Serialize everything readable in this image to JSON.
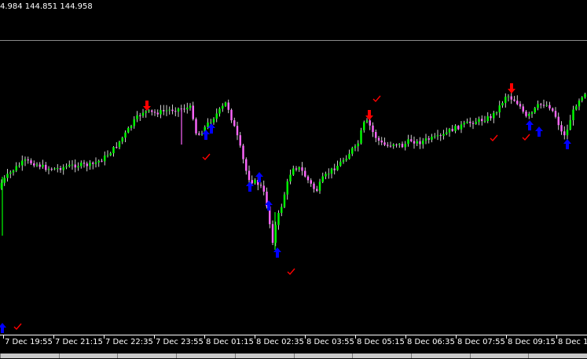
{
  "header": {
    "ohlc_text": "4.984 144.851 144.958"
  },
  "time_axis": {
    "labels": [
      "7 Dec 19:55",
      "7 Dec 21:15",
      "7 Dec 22:35",
      "7 Dec 23:55",
      "8 Dec 01:15",
      "8 Dec 02:35",
      "8 Dec 03:55",
      "8 Dec 05:15",
      "8 Dec 06:35",
      "8 Dec 07:55",
      "8 Dec 09:15",
      "8 Dec 10"
    ]
  },
  "tabs": [
    "",
    "",
    "",
    "",
    "",
    "",
    "",
    "",
    "",
    ""
  ],
  "colors": {
    "background": "#000000",
    "bull": "#00ff00",
    "bear": "#ff66ff",
    "wick": "#ffffff",
    "buy_arrow": "#0000ff",
    "sell_arrow": "#ff0000",
    "check": "#ff0000"
  },
  "chart_data": {
    "type": "candlestick",
    "price_path": [
      40,
      55,
      80,
      85,
      62,
      58,
      62,
      65,
      62,
      60,
      64,
      62,
      60,
      58,
      58,
      55,
      52,
      52,
      50,
      46,
      40,
      30,
      22,
      12,
      10,
      8,
      6,
      5,
      5,
      6,
      6,
      6,
      6,
      6,
      7,
      8,
      12,
      20,
      28,
      40,
      35,
      28,
      20,
      10,
      6,
      2,
      -5,
      -5,
      -8,
      -4,
      0,
      2,
      -10,
      -18,
      -18,
      -15,
      -5,
      -2,
      -5,
      -8,
      -5,
      -2,
      0
    ],
    "signals": [
      {
        "type": "sell",
        "index": 17
      },
      {
        "type": "buy",
        "index": 60
      },
      {
        "type": "buy",
        "index": 62
      },
      {
        "type": "buy",
        "index": 75
      },
      {
        "type": "buy",
        "index": 78
      },
      {
        "type": "buy",
        "index": 82
      },
      {
        "type": "buy",
        "index": 84
      },
      {
        "type": "buy",
        "index": 87
      },
      {
        "type": "sell",
        "index": 119
      },
      {
        "type": "sell",
        "index": 168
      },
      {
        "type": "buy",
        "index": 171
      },
      {
        "type": "buy",
        "index": 176
      },
      {
        "type": "buy",
        "index": 186
      }
    ]
  }
}
